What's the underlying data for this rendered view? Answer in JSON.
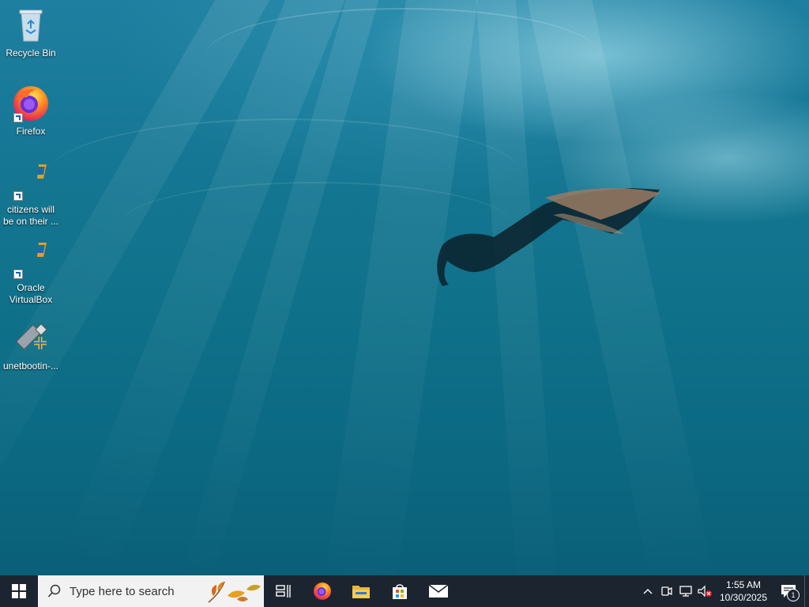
{
  "desktop": {
    "icons": [
      {
        "label": "Recycle Bin",
        "icon": "recycle-bin-icon"
      },
      {
        "label": "Firefox",
        "icon": "firefox-icon"
      },
      {
        "label": "citizens will be on their ...",
        "icon": "virtualbox-icon"
      },
      {
        "label": "Oracle VirtualBox",
        "icon": "virtualbox-icon"
      },
      {
        "label": "unetbootin-...",
        "icon": "unetbootin-icon"
      }
    ]
  },
  "taskbar": {
    "search_placeholder": "Type here to search",
    "apps": [
      {
        "name": "Task View",
        "icon": "task-view-icon"
      },
      {
        "name": "Firefox",
        "icon": "firefox-icon"
      },
      {
        "name": "File Explorer",
        "icon": "file-explorer-icon"
      },
      {
        "name": "Microsoft Store",
        "icon": "store-icon"
      },
      {
        "name": "Mail",
        "icon": "mail-icon"
      }
    ],
    "tray": {
      "time": "1:55 AM",
      "date": "10/30/2025",
      "notification_count": "1"
    }
  },
  "colors": {
    "taskbar": "#1c2430",
    "search_box": "#f2f2f2",
    "water_top": "#1f7fa0",
    "water_bottom": "#0a5f78"
  }
}
